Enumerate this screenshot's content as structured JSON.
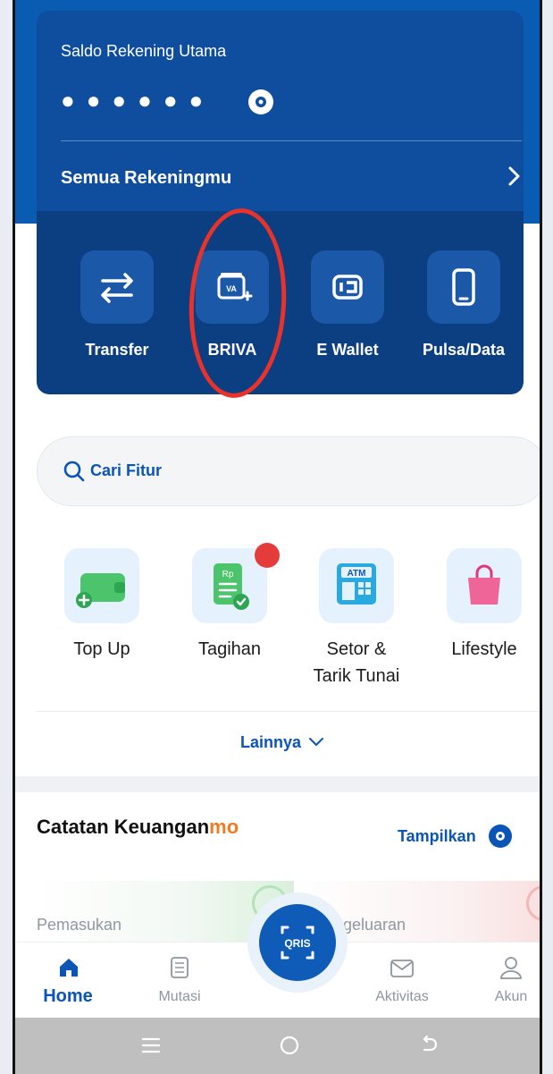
{
  "header": {
    "saldo_label": "Saldo Rekening Utama",
    "masked_balance": "●●●●●●",
    "semua_label": "Semua Rekeningmu"
  },
  "quick_actions": [
    {
      "label": "Transfer",
      "icon": "transfer-icon"
    },
    {
      "label": "BRIVA",
      "icon": "briva-icon"
    },
    {
      "label": "E Wallet",
      "icon": "wallet-icon"
    },
    {
      "label": "Pulsa/Data",
      "icon": "phone-icon"
    }
  ],
  "search": {
    "placeholder": "Cari Fitur"
  },
  "features": [
    {
      "label_line1": "Top Up",
      "label_line2": "",
      "icon": "wallet-plus-icon"
    },
    {
      "label_line1": "Tagihan",
      "label_line2": "",
      "icon": "bill-icon",
      "badge": true
    },
    {
      "label_line1": "Setor &",
      "label_line2": "Tarik Tunai",
      "icon": "atm-icon"
    },
    {
      "label_line1": "Lifestyle",
      "label_line2": "",
      "icon": "shopping-bag-icon"
    }
  ],
  "lainnya": "Lainnya",
  "catatan": {
    "title_main": "Catatan Keuangan",
    "title_brand": "mo",
    "show_label": "Tampilkan"
  },
  "finance": {
    "pemasukan": "Pemasukan",
    "pengeluaran_visible": "ngeluaran"
  },
  "qris_label": "QRIS",
  "nav": [
    {
      "label": "Home",
      "icon": "home-icon"
    },
    {
      "label": "Mutasi",
      "icon": "receipt-icon"
    },
    {
      "label": "Aktivitas",
      "icon": "mail-icon"
    },
    {
      "label": "Akun",
      "icon": "account-icon"
    }
  ],
  "colors": {
    "primary": "#0a55b5",
    "header": "#0f4d9e",
    "header_dark": "#0c3f82",
    "annotation": "#e8322a",
    "badge": "#e63b3b"
  }
}
